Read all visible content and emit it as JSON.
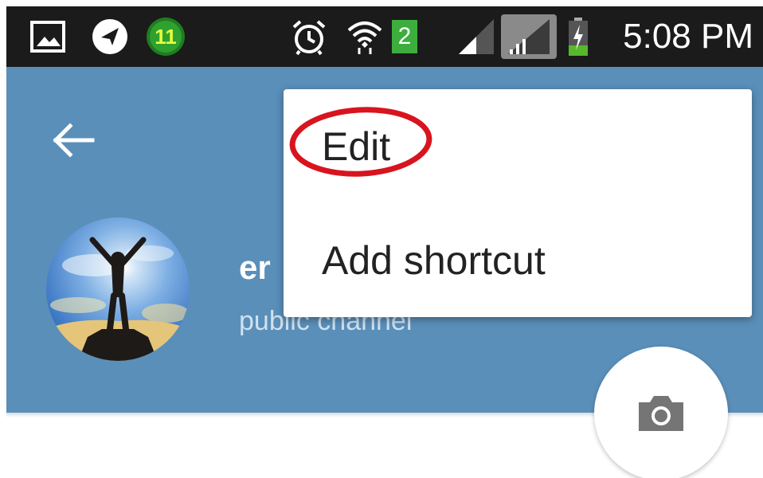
{
  "status_bar": {
    "time": "5:08 PM",
    "icons": [
      "gallery-icon",
      "navigation-icon",
      "app-badge-icon",
      "alarm-icon",
      "wifi-icon",
      "sim-2-icon",
      "signal-icon",
      "signal-icon",
      "battery-charging-icon"
    ],
    "app_badge_text": "11",
    "sim_number": "2"
  },
  "header": {
    "back_icon": "arrow-left-icon",
    "channel_name": "er",
    "channel_status": "public channel",
    "background_color": "#5a8fb9"
  },
  "menu": {
    "items": [
      {
        "label": "Edit"
      },
      {
        "label": "Add shortcut"
      }
    ],
    "highlight_color": "#d8141e"
  },
  "fab": {
    "icon": "camera-icon"
  }
}
